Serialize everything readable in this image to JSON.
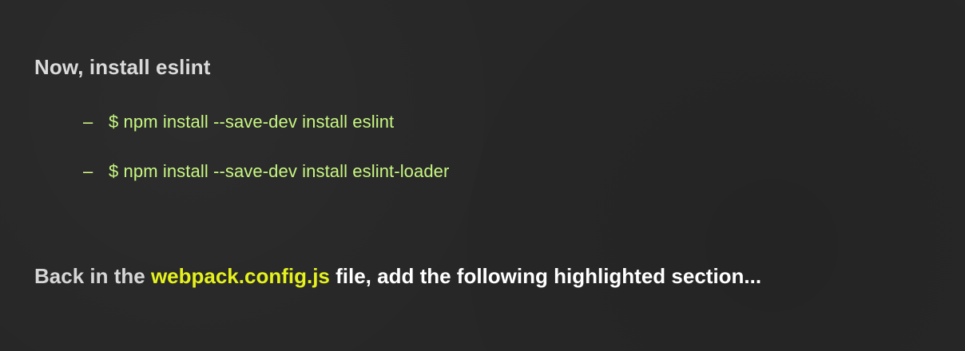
{
  "heading": "Now, install eslint",
  "commands": [
    {
      "bullet": "–",
      "text": "$ npm install --save-dev install eslint"
    },
    {
      "bullet": "–",
      "text": "$ npm install --save-dev install eslint-loader"
    }
  ],
  "footer": {
    "lead": "Back in the ",
    "filename": "webpack.config.js",
    "tail": " file, add the following highlighted section..."
  },
  "colors": {
    "background": "#272727",
    "heading": "#dadada",
    "command": "#c7f781",
    "filename_highlight": "#e5f21c",
    "footer_text": "#ffffff"
  }
}
